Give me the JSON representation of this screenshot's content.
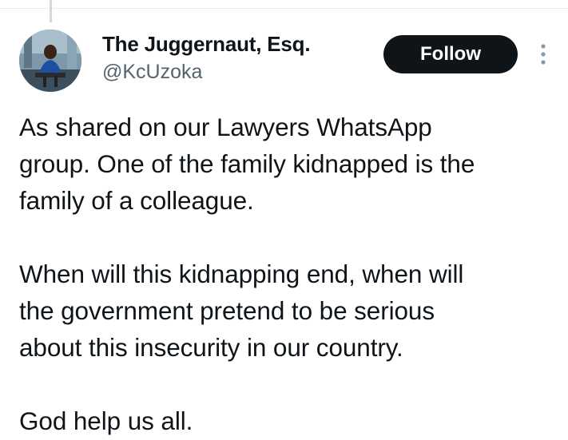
{
  "author": {
    "display_name": "The Juggernaut, Esq.",
    "handle": "@KcUzoka",
    "avatar_icon": "profile-photo"
  },
  "actions": {
    "follow_label": "Follow",
    "more_icon": "more-vertical-icon"
  },
  "tweet": {
    "paragraphs": [
      [
        "As shared on our Lawyers WhatsApp",
        "group. One of the family kidnapped is the",
        "family of a colleague."
      ],
      [
        "When will this kidnapping end, when will",
        "the government pretend to be serious",
        "about this insecurity in our country."
      ],
      [
        "God help us all."
      ]
    ]
  },
  "colors": {
    "text": "#0f1419",
    "secondary_text": "#536471",
    "button_bg": "#0f1419",
    "button_text": "#ffffff",
    "divider": "#e6ecf0"
  }
}
